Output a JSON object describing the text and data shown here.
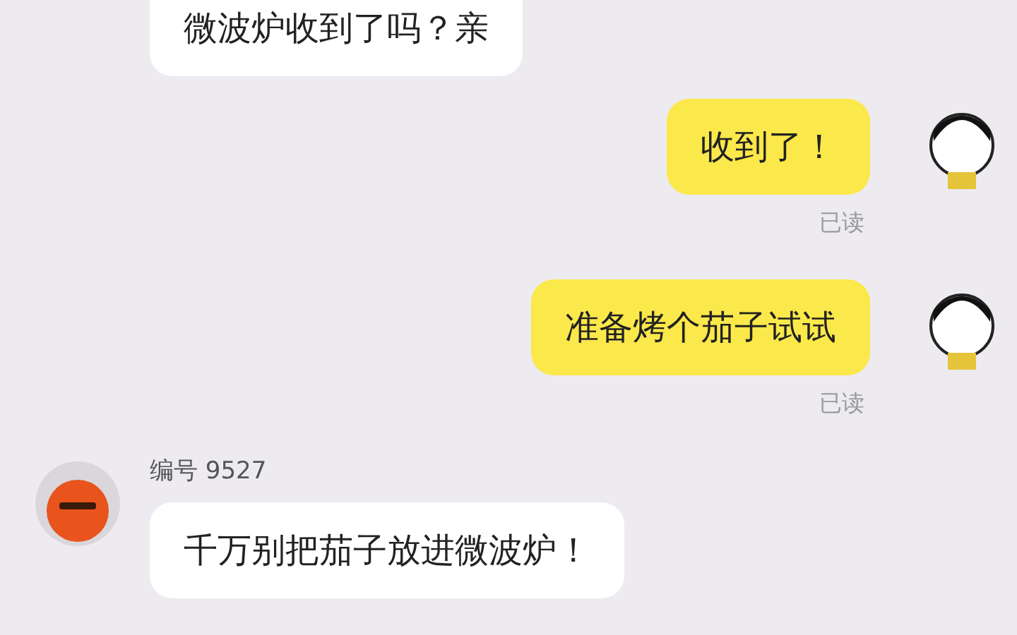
{
  "messages": [
    {
      "kind": "incoming",
      "text": "微波炉收到了吗？亲"
    },
    {
      "kind": "outgoing",
      "text": "收到了！",
      "status": "已读"
    },
    {
      "kind": "outgoing",
      "text": "准备烤个茄子试试",
      "status": "已读"
    },
    {
      "kind": "incoming",
      "sender": "编号 9527",
      "text": "千万别把茄子放进微波炉！"
    }
  ]
}
